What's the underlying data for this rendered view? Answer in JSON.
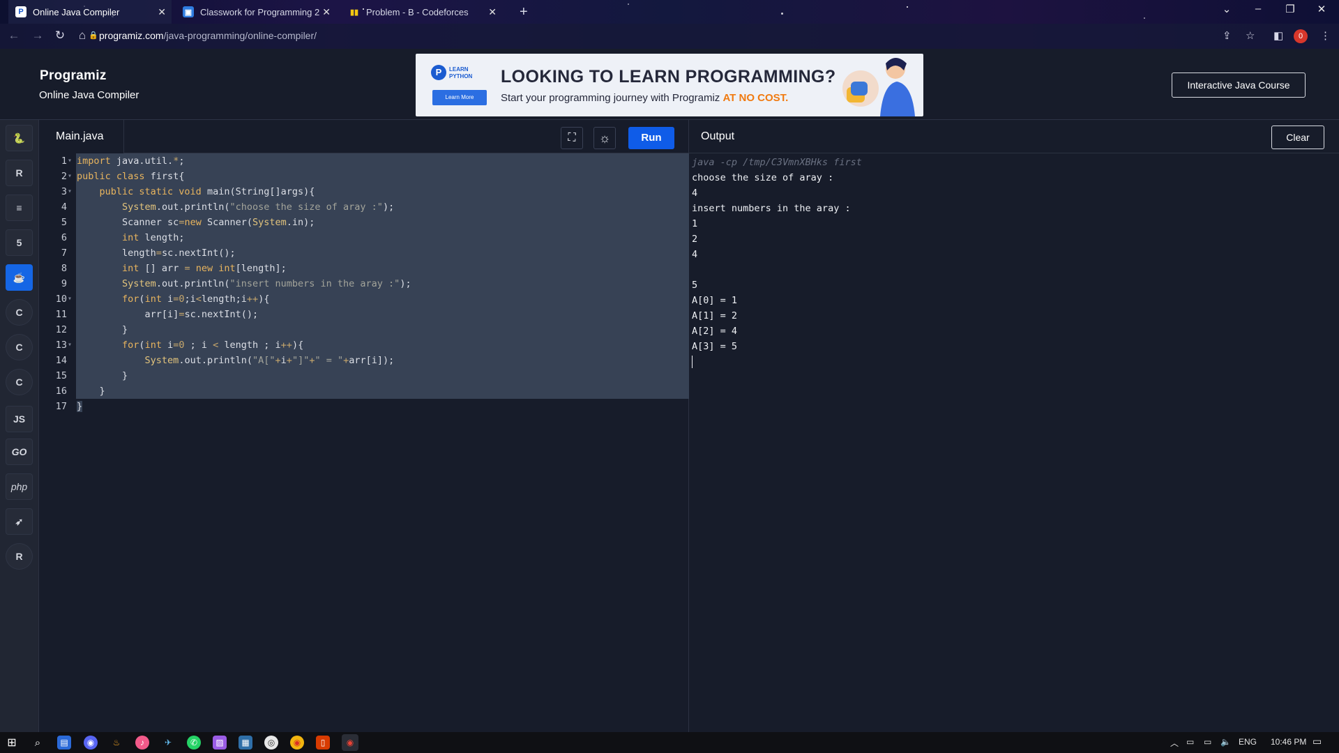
{
  "browser": {
    "tabs": [
      {
        "title": "Online Java Compiler",
        "active": true,
        "icon": "programiz-favicon"
      },
      {
        "title": "Classwork for Programming 2",
        "active": false,
        "icon": "classroom-favicon"
      },
      {
        "title": "Problem - B - Codeforces",
        "active": false,
        "icon": "codeforces-favicon"
      }
    ],
    "close_glyph": "✕",
    "new_tab_glyph": "+",
    "url_host": "programiz.com",
    "url_path": "/java-programming/online-compiler/",
    "profile_initial": "0"
  },
  "header": {
    "logo": "Programiz",
    "subtitle": "Online Java Compiler",
    "course_button": "Interactive Java Course"
  },
  "ad": {
    "badge_line1": "LEARN",
    "badge_line2": "PYTHON",
    "learn_more": "Learn More",
    "title": "LOOKING TO LEARN PROGRAMMING?",
    "subtitle_prefix": "Start your programming journey with Programiz ",
    "subtitle_accent": "AT NO COST.",
    "accent_color": "#f07a10"
  },
  "sidebar": {
    "languages": [
      {
        "name": "python",
        "glyph": "🐍"
      },
      {
        "name": "r",
        "glyph": "R"
      },
      {
        "name": "sql",
        "glyph": "≡"
      },
      {
        "name": "html",
        "glyph": "5"
      },
      {
        "name": "java",
        "glyph": "☕",
        "active": true
      },
      {
        "name": "c",
        "glyph": "C"
      },
      {
        "name": "cpp",
        "glyph": "C"
      },
      {
        "name": "csharp",
        "glyph": "C"
      },
      {
        "name": "js",
        "glyph": "JS"
      },
      {
        "name": "go",
        "glyph": "GO"
      },
      {
        "name": "php",
        "glyph": "php"
      },
      {
        "name": "swift",
        "glyph": "➶"
      },
      {
        "name": "rust",
        "glyph": "R"
      }
    ]
  },
  "editor": {
    "file_name": "Main.java",
    "run_label": "Run",
    "fullscreen_glyph": "⛶",
    "theme_glyph": "☼",
    "accent_color": "#0f5ce8"
  },
  "output": {
    "title": "Output",
    "clear_label": "Clear",
    "command": "java -cp /tmp/C3VmnXBHks first",
    "lines": [
      "choose the size of aray :",
      "4",
      "insert numbers in the aray :",
      "1",
      "2",
      "4",
      "",
      "5",
      "A[0] = 1",
      "A[1] = 2",
      "A[2] = 4",
      "A[3] = 5"
    ]
  },
  "taskbar": {
    "language": "ENG",
    "time": "10:46 PM"
  }
}
